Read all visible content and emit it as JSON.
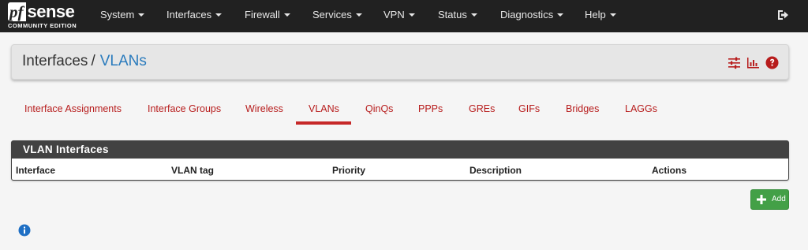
{
  "brand": {
    "name_pf": "pf",
    "name_sense": "sense",
    "edition": "COMMUNITY EDITION"
  },
  "nav": {
    "items": [
      {
        "label": "System"
      },
      {
        "label": "Interfaces"
      },
      {
        "label": "Firewall"
      },
      {
        "label": "Services"
      },
      {
        "label": "VPN"
      },
      {
        "label": "Status"
      },
      {
        "label": "Diagnostics"
      },
      {
        "label": "Help"
      }
    ],
    "logout_icon": "sign-out-icon"
  },
  "header": {
    "crumb_parent": "Interfaces",
    "separator": "/",
    "crumb_current": "VLANs",
    "icons": [
      "sliders-icon",
      "bar-chart-icon",
      "question-circle-icon"
    ],
    "accent_color": "#b71c1c"
  },
  "tabs": {
    "items": [
      {
        "label": "Interface Assignments"
      },
      {
        "label": "Interface Groups"
      },
      {
        "label": "Wireless"
      },
      {
        "label": "VLANs",
        "active": true
      },
      {
        "label": "QinQs"
      },
      {
        "label": "PPPs"
      },
      {
        "label": "GREs"
      },
      {
        "label": "GIFs"
      },
      {
        "label": "Bridges"
      },
      {
        "label": "LAGGs"
      }
    ]
  },
  "table": {
    "title": "VLAN Interfaces",
    "columns": [
      "Interface",
      "VLAN tag",
      "Priority",
      "Description",
      "Actions"
    ],
    "rows": []
  },
  "actions": {
    "add_label": "Add",
    "add_icon": "plus-icon",
    "add_color": "#43a047"
  },
  "footer": {
    "info_icon": "info-circle-icon"
  }
}
